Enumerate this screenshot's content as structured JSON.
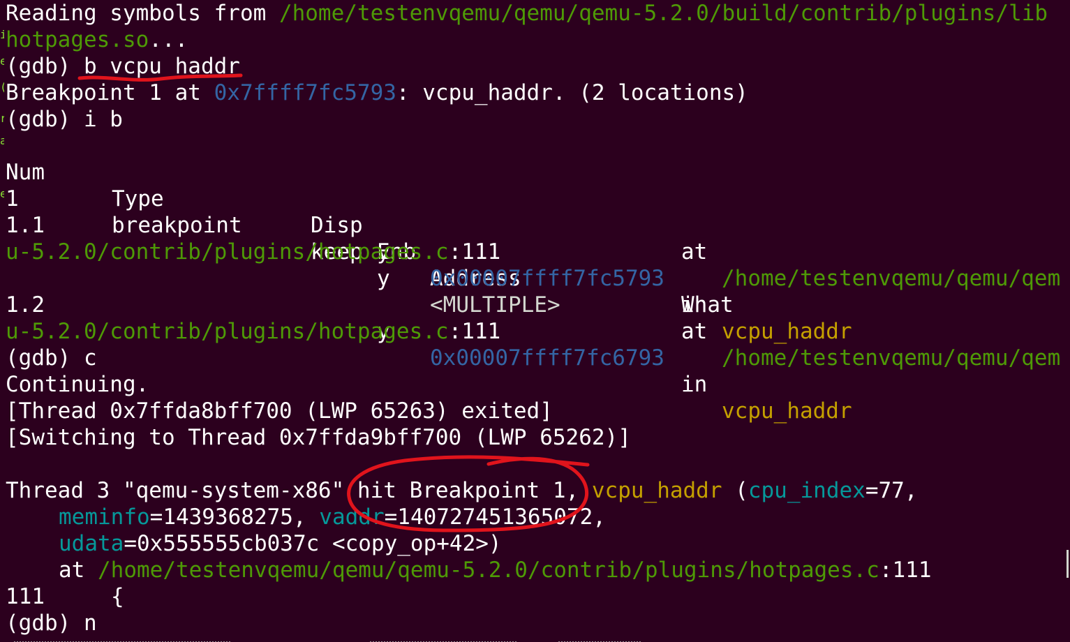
{
  "terminal": {
    "lines": {
      "reading": {
        "label": "Reading symbols from ",
        "path": "/home/testenvqemu/qemu/qemu-5.2.0/build/contrib/plugins/lib"
      },
      "reading_cont": {
        "path": "hotpages.so",
        "tail": "..."
      },
      "cmd_break": {
        "prompt": "(gdb) ",
        "command": "b vcpu_haddr"
      },
      "bp_set": {
        "pre": "Breakpoint 1 at ",
        "addr": "0x7ffff7fc5793",
        "post": ": vcpu_haddr. (2 locations)"
      },
      "cmd_info": {
        "prompt": "(gdb) ",
        "command": "i b"
      },
      "table_header": {
        "num": "Num",
        "type": "Type",
        "disp": "Disp",
        "enb": "Enb",
        "address": "Address",
        "what": "What"
      },
      "row1": {
        "num": "1",
        "type": "breakpoint",
        "disp": "keep",
        "enb": "y",
        "address": "<MULTIPLE>"
      },
      "row1_1": {
        "num": "1.1",
        "enb": "y",
        "address": "0x00007ffff7fc5793",
        "in": "in ",
        "func": "vcpu_haddr"
      },
      "row1_1_at": {
        "at": "at ",
        "path": "/home/testenvqemu/qemu/qem"
      },
      "row1_1_cont": {
        "path": "u-5.2.0/contrib/plugins/hotpages.c",
        "line": ":111"
      },
      "row1_2": {
        "num": "1.2",
        "enb": "y",
        "address": "0x00007ffff7fc6793",
        "in": "in ",
        "func": "vcpu_haddr"
      },
      "row1_2_at": {
        "at": "at ",
        "path": "/home/testenvqemu/qemu/qem"
      },
      "row1_2_cont": {
        "path": "u-5.2.0/contrib/plugins/hotpages.c",
        "line": ":111"
      },
      "cmd_continue": {
        "prompt": "(gdb) ",
        "command": "c"
      },
      "continuing": "Continuing.",
      "thread_exit": "[Thread 0x7ffda8bff700 (LWP 65263) exited]",
      "switching": "[Switching to Thread 0x7ffda9bff700 (LWP 65262)]",
      "hit": {
        "pre": "Thread 3 \"qemu-system-x86\" ",
        "hit": "hit Breakpoint 1",
        "sep": ", ",
        "func": "vcpu_haddr",
        "open": " (",
        "arg1": "cpu_index",
        "val1": "=77,",
        "arg2": "meminfo",
        "val2": "=1439368275, ",
        "arg3": "vaddr",
        "val3": "=140727451365072,",
        "arg4": "udata",
        "val4": "=0x555555cb037c <copy_op+42>)",
        "at": "at ",
        "path": "/home/testenvqemu/qemu/qemu-5.2.0/contrib/plugins/hotpages.c",
        "line": ":111"
      },
      "source": {
        "lineno": "111",
        "code": "{"
      },
      "cmd_next": {
        "prompt": "(gdb) ",
        "command": "n"
      }
    },
    "left_edge_glyphs": [
      "i",
      "e",
      "(",
      "r",
      "a",
      "e",
      "i"
    ],
    "colors": {
      "background": "#2c001e",
      "text": "#ffffff",
      "path_green": "#4e9a06",
      "address_blue": "#3465a4",
      "function_yellow": "#c4a000",
      "arg_cyan": "#06989a",
      "annotation_red": "#e0141c"
    }
  }
}
